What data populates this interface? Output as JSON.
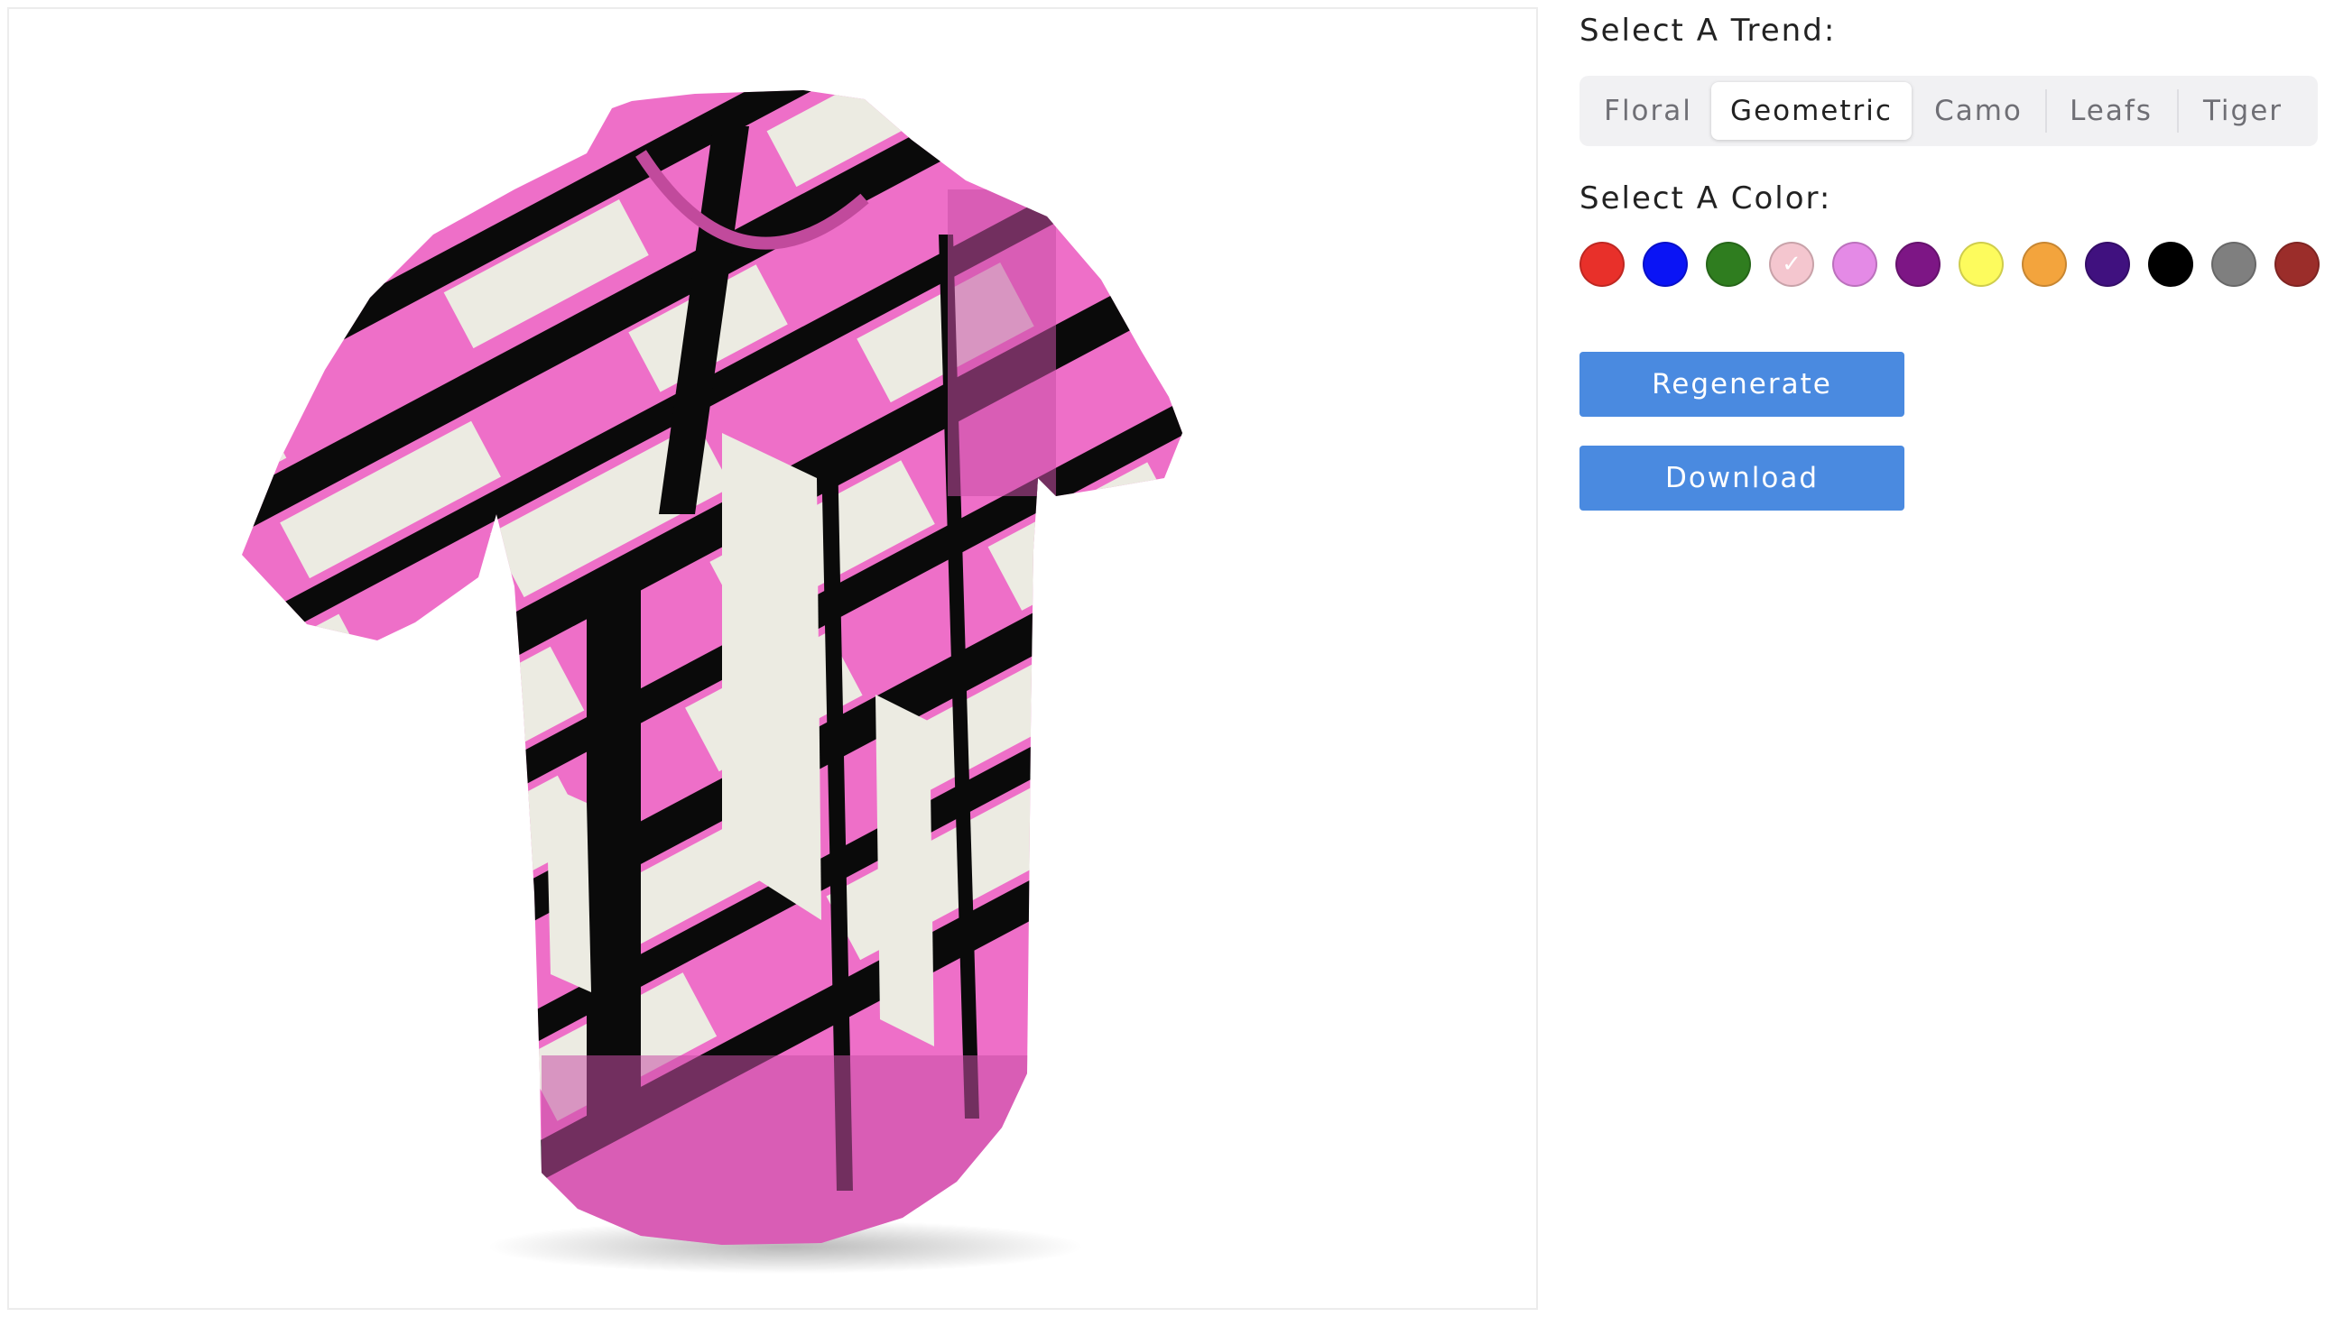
{
  "preview": {
    "image_name": "tshirt-3d-model",
    "pattern": "pink black white geometric"
  },
  "trend": {
    "heading": "Select A Trend:",
    "tabs": [
      {
        "label": "Floral",
        "active": false
      },
      {
        "label": "Geometric",
        "active": true
      },
      {
        "label": "Camo",
        "active": false
      },
      {
        "label": "Leafs",
        "active": false
      },
      {
        "label": "Tiger",
        "active": false
      }
    ]
  },
  "color": {
    "heading": "Select A Color:",
    "selected_index": 3,
    "swatches": [
      "#e8302a",
      "#0a14f5",
      "#2f7d1f",
      "#f4c6cf",
      "#e48ae6",
      "#7d1685",
      "#fdfb5d",
      "#f3a43d",
      "#40117f",
      "#000000",
      "#7f7f7f",
      "#9b2d2a"
    ]
  },
  "actions": {
    "regenerate_label": "Regenerate",
    "download_label": "Download"
  }
}
